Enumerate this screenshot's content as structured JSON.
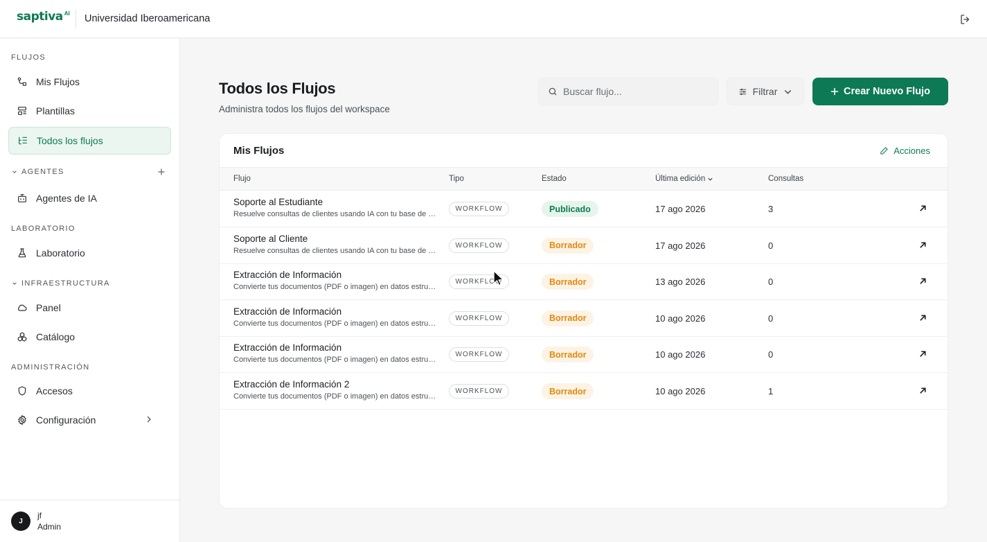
{
  "header": {
    "logo_text": "saptiva",
    "logo_ai": "AI",
    "org_name": "Universidad Iberoamericana",
    "logout_icon": "logout-icon"
  },
  "sidebar": {
    "sections": {
      "flujos": "FLUJOS",
      "agentes": "AGENTES",
      "laboratorio": "LABORATORIO",
      "infraestructura": "INFRAESTRUCTURA",
      "administracion": "ADMINISTRACIÓN"
    },
    "items": [
      {
        "label": "Mis Flujos",
        "icon": "flows-icon"
      },
      {
        "label": "Plantillas",
        "icon": "templates-icon"
      },
      {
        "label": "Todos los flujos",
        "icon": "list-tree-icon",
        "active": true
      },
      {
        "label": "Agentes de IA",
        "icon": "bot-icon"
      },
      {
        "label": "Laboratorio",
        "icon": "flask-icon"
      },
      {
        "label": "Panel",
        "icon": "cloud-icon"
      },
      {
        "label": "Catálogo",
        "icon": "boxes-icon"
      },
      {
        "label": "Accesos",
        "icon": "shield-icon"
      },
      {
        "label": "Configuración",
        "icon": "gear-icon"
      }
    ],
    "user": {
      "initial": "J",
      "name": "jf",
      "role": "Admin"
    }
  },
  "main": {
    "title": "Todos los Flujos",
    "subtitle": "Administra todos los flujos del workspace",
    "search_placeholder": "Buscar flujo...",
    "filter_label": "Filtrar",
    "create_label": "Crear Nuevo Flujo"
  },
  "card": {
    "title": "Mis Flujos",
    "actions_label": "Acciones",
    "columns": {
      "flujo": "Flujo",
      "tipo": "Tipo",
      "estado": "Estado",
      "edicion": "Última edición",
      "consultas": "Consultas"
    },
    "rows": [
      {
        "name": "Soporte al Estudiante",
        "desc": "Resuelve consultas de clientes usando IA con tu base de conocimiento",
        "type": "WORKFLOW",
        "status": "Publicado",
        "status_kind": "pub",
        "date": "17 ago 2026",
        "count": "3"
      },
      {
        "name": "Soporte al Cliente",
        "desc": "Resuelve consultas de clientes usando IA con tu base de conocimiento",
        "type": "WORKFLOW",
        "status": "Borrador",
        "status_kind": "draft",
        "date": "17 ago 2026",
        "count": "0"
      },
      {
        "name": "Extracción de Información",
        "desc": "Convierte tus documentos (PDF o imagen) en datos estructurados",
        "type": "WORKFLOW",
        "status": "Borrador",
        "status_kind": "draft",
        "date": "13 ago 2026",
        "count": "0"
      },
      {
        "name": "Extracción de Información",
        "desc": "Convierte tus documentos (PDF o imagen) en datos estructurados",
        "type": "WORKFLOW",
        "status": "Borrador",
        "status_kind": "draft",
        "date": "10 ago 2026",
        "count": "0"
      },
      {
        "name": "Extracción de Información",
        "desc": "Convierte tus documentos (PDF o imagen) en datos estructurados",
        "type": "WORKFLOW",
        "status": "Borrador",
        "status_kind": "draft",
        "date": "10 ago 2026",
        "count": "0"
      },
      {
        "name": "Extracción de Información 2",
        "desc": "Convierte tus documentos (PDF o imagen) en datos estructurados",
        "type": "WORKFLOW",
        "status": "Borrador",
        "status_kind": "draft",
        "date": "10 ago 2026",
        "count": "1"
      }
    ]
  },
  "colors": {
    "brand": "#0d7a55",
    "draft": "#e08a10",
    "published_bg": "#e6f5ec",
    "draft_bg": "#fdf3e4"
  }
}
